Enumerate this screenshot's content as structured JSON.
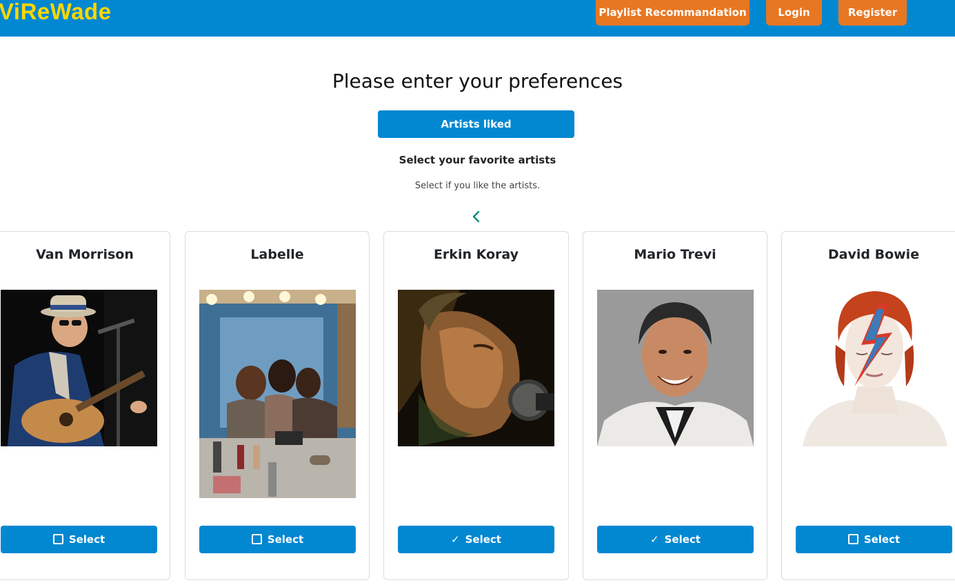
{
  "navbar": {
    "brand": "ViReWade",
    "playlist_label": "Playlist Recommandation",
    "login_label": "Login",
    "register_label": "Register"
  },
  "main": {
    "title": "Please enter your preferences",
    "artists_liked_label": "Artists liked",
    "section_heading": "Select your favorite artists",
    "section_sub": "Select if you like the artists.",
    "prev_icon": "chevron-left-icon"
  },
  "artists": [
    {
      "name": "Van Morrison",
      "select_label": "Select",
      "selected": false
    },
    {
      "name": "Labelle",
      "select_label": "Select",
      "selected": false
    },
    {
      "name": "Erkin Koray",
      "select_label": "Select",
      "selected": true
    },
    {
      "name": "Mario Trevi",
      "select_label": "Select",
      "selected": true
    },
    {
      "name": "David Bowie",
      "select_label": "Select",
      "selected": false
    }
  ],
  "colors": {
    "navbar": "#0288d1",
    "brand": "#ffd600",
    "nav_button": "#e87722",
    "primary_button": "#0288d1",
    "arrow": "#00897b"
  }
}
